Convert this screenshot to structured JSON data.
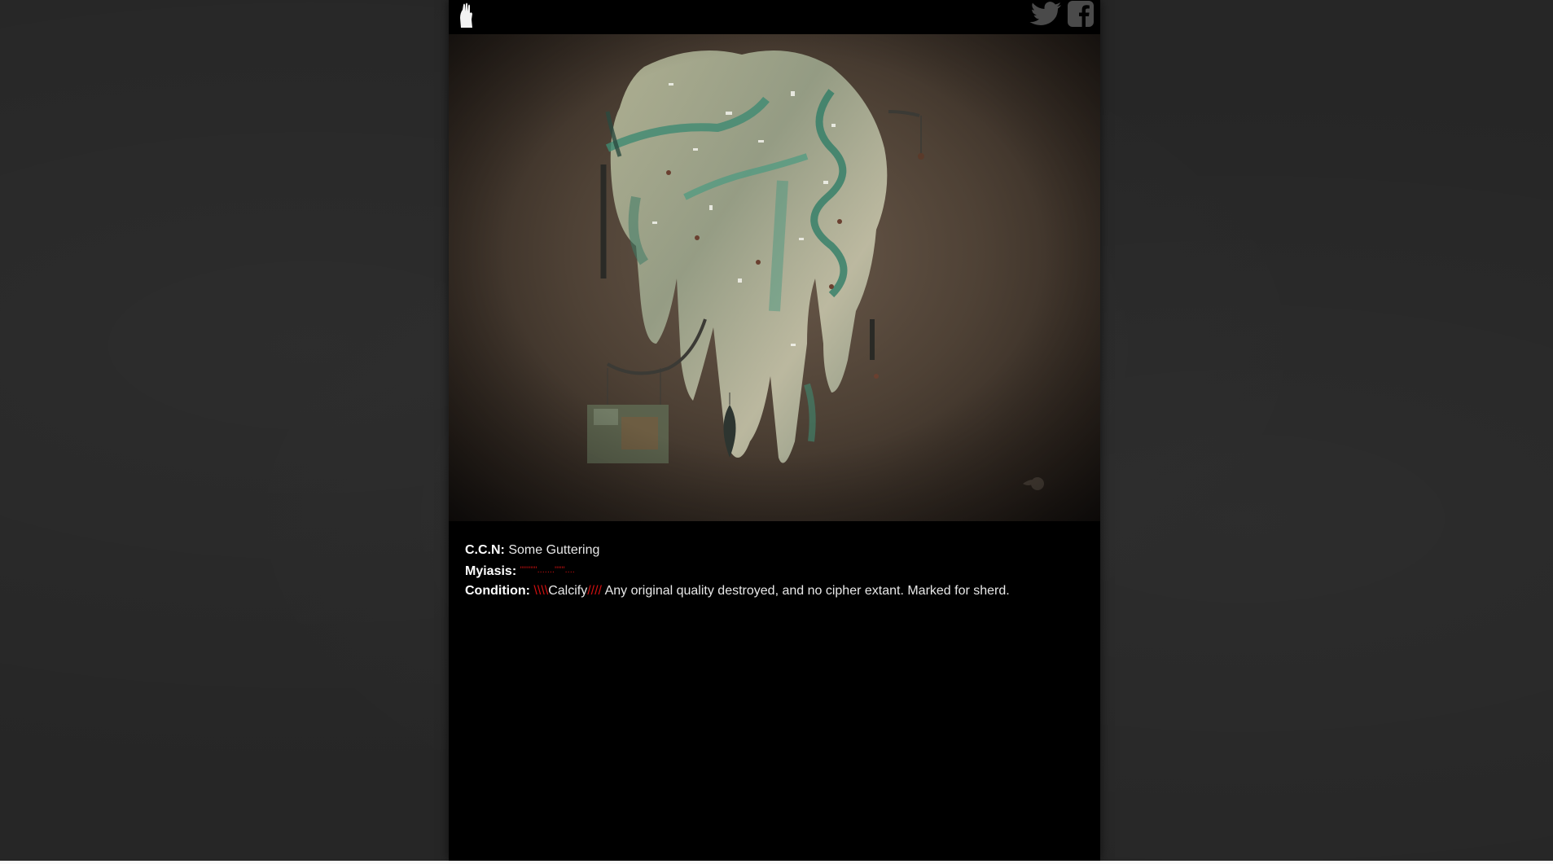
{
  "header": {
    "logo_icon": "hand-logo-icon",
    "twitter_icon": "twitter-icon",
    "facebook_icon": "facebook-icon"
  },
  "artwork": {
    "subject": "hanging-glass-sculpture"
  },
  "record": {
    "ccn_label": "C.C.N:",
    "ccn_value": "Some Guttering",
    "myiasis_label": "Myiasis:",
    "myiasis_value": "''''''''''.......''''''....",
    "condition_label": "Condition:",
    "condition_prefix": "\\\\\\\\",
    "condition_word": "Calcify",
    "condition_suffix": "////",
    "condition_text": "Any original quality destroyed, and no cipher extant. Marked for sherd."
  },
  "colors": {
    "background": "#262626",
    "panel": "#000000",
    "text": "#e8e8e8",
    "accent_red": "#d01010"
  }
}
